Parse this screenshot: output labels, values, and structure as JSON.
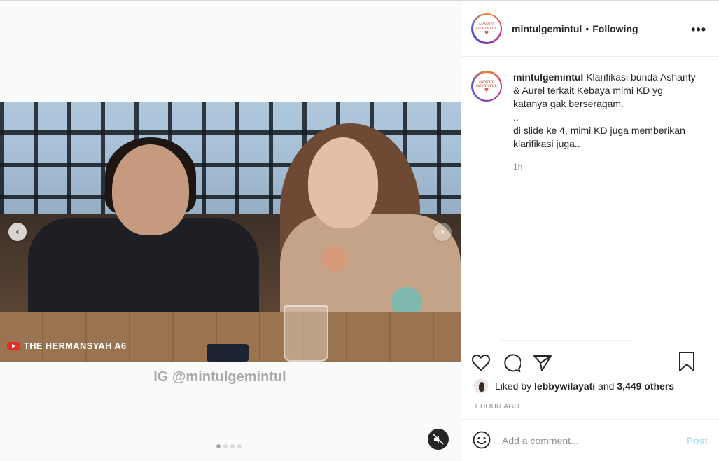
{
  "media": {
    "yt_watermark": "THE HERMANSYAH A6",
    "ig_watermark": "IG @mintulgemintul",
    "prev_glyph": "‹",
    "next_glyph": "›",
    "slides_total": 4,
    "slide_active": 1
  },
  "header": {
    "avatar_text_line1": "MINTUL",
    "avatar_text_line2": "GEMINTUL",
    "avatar_heart": "♥",
    "username": "mintulgemintul",
    "separator": "•",
    "follow_status": "Following",
    "more_glyph": "•••"
  },
  "caption": {
    "username": "mintulgemintul",
    "lines": [
      "Klarifikasi bunda Ashanty & Aurel terkait Kebaya mimi KD yg katanya gak berseragam.",
      "..",
      "di slide ke 4, mimi KD juga memberikan klarifikasi juga.."
    ],
    "time": "1h"
  },
  "likes": {
    "prefix": "Liked by",
    "user": "lebbywilayati",
    "joiner": "and",
    "others": "3,449 others"
  },
  "post_time": "1 HOUR AGO",
  "comment": {
    "placeholder": "Add a comment...",
    "post_label": "Post"
  },
  "icons": {
    "like": "heart-icon",
    "comment": "comment-icon",
    "share": "share-icon",
    "save": "bookmark-icon",
    "emoji": "emoji-icon",
    "mute": "mute-icon"
  },
  "colors": {
    "post_button_disabled": "#b2dffc",
    "muted_text": "#8e8e8e",
    "primary_text": "#262626"
  }
}
